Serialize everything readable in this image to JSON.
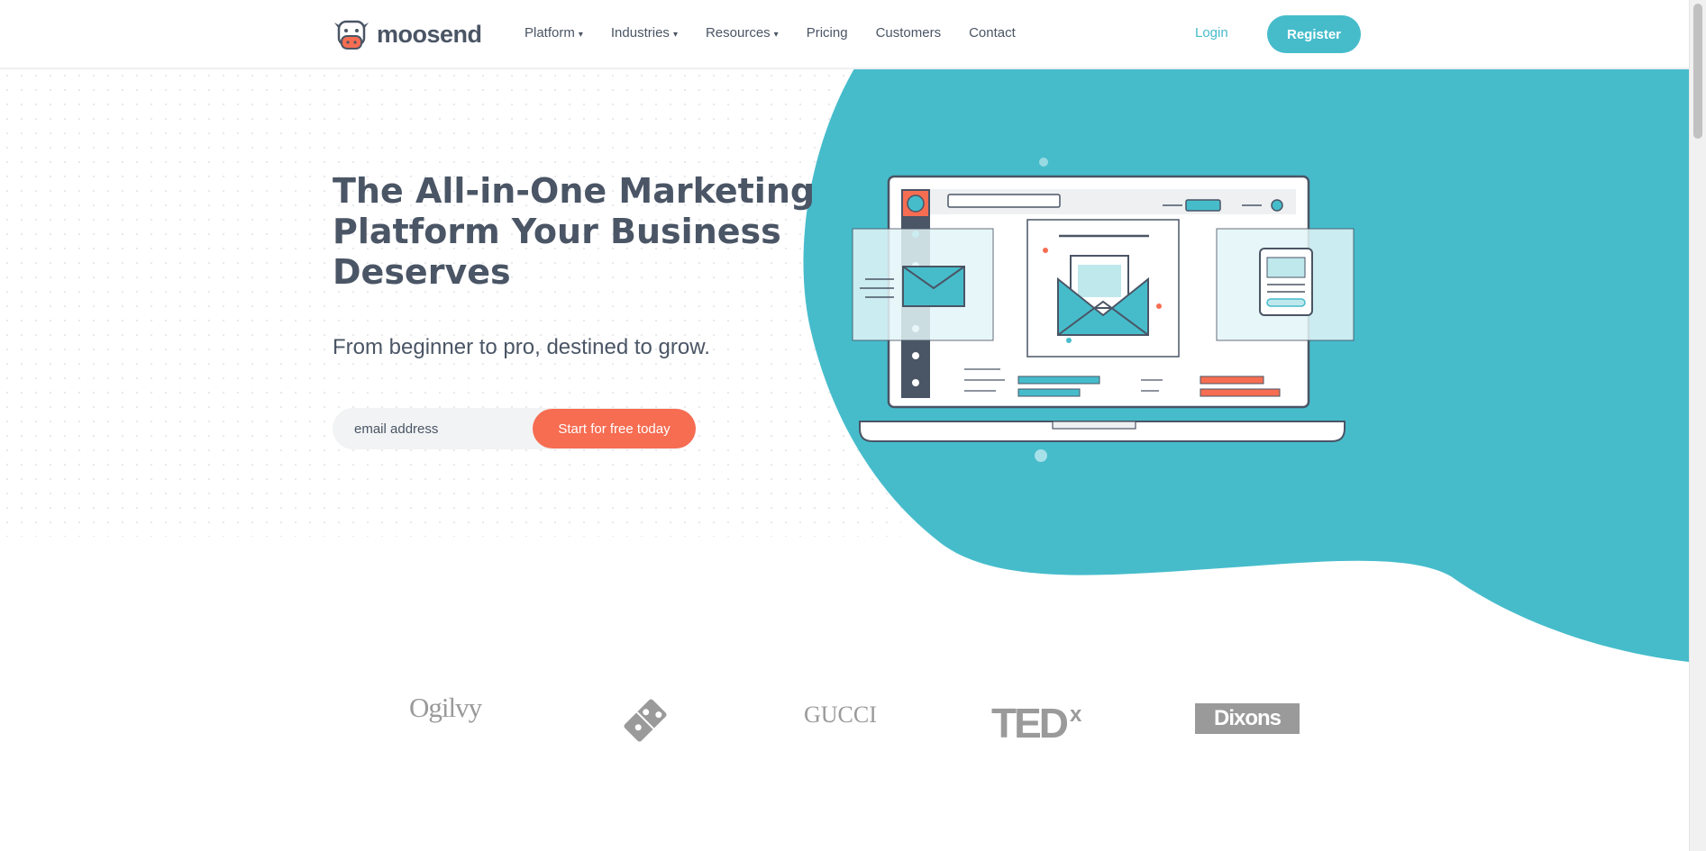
{
  "header": {
    "brand": "moosend",
    "nav": [
      {
        "label": "Platform",
        "has_dropdown": true
      },
      {
        "label": "Industries",
        "has_dropdown": true
      },
      {
        "label": "Resources",
        "has_dropdown": true
      },
      {
        "label": "Pricing",
        "has_dropdown": false
      },
      {
        "label": "Customers",
        "has_dropdown": false
      },
      {
        "label": "Contact",
        "has_dropdown": false
      }
    ],
    "caret": "▾",
    "login_label": "Login",
    "register_label": "Register"
  },
  "hero": {
    "title": "The All-in-One Marketing Platform Your Business Deserves",
    "subtitle": "From beginner to pro, destined to grow.",
    "email_placeholder": "email address",
    "cta_label": "Start for free today"
  },
  "clients": {
    "ogilvy": "Ogilvy",
    "gucci": "GUCCI",
    "tedx_main": "TED",
    "tedx_sup": "x",
    "dixons": "Dixons"
  },
  "colors": {
    "teal": "#46bccb",
    "coral": "#f66d52",
    "text": "#4a5565",
    "logo_gray": "#9a9a9a"
  },
  "icons": [
    "moosend-cow-logo-icon",
    "dominos-logo-icon",
    "email-envelope-icon",
    "image-icon",
    "laptop-illustration-icon"
  ]
}
